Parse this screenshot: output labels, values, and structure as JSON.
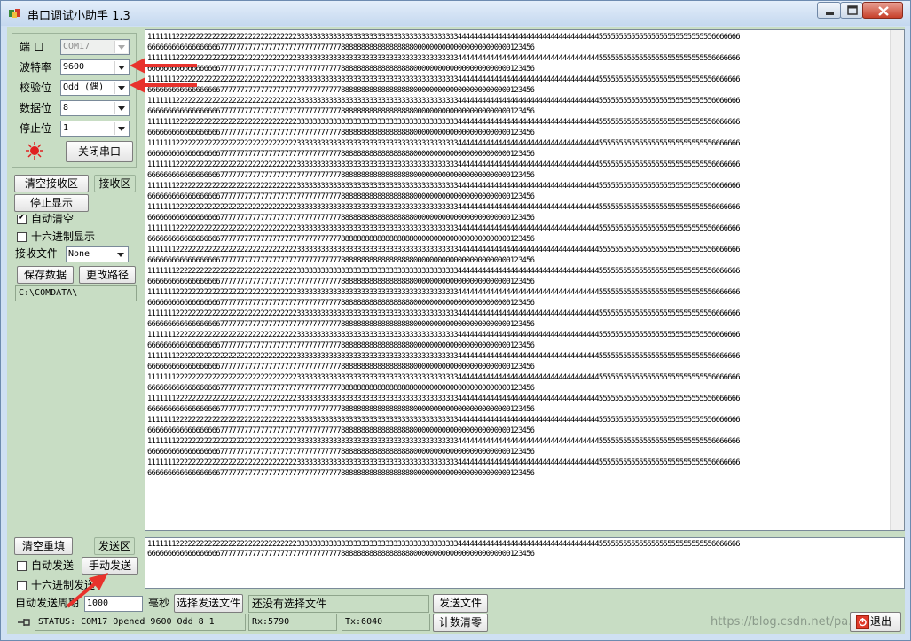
{
  "window": {
    "title": "串口调试小助手 1.3"
  },
  "port": {
    "port_label": "端  口",
    "port_value": "COM17",
    "baud_label": "波特率",
    "baud_value": "9600",
    "parity_label": "校验位",
    "parity_value": "Odd  (偶)",
    "databits_label": "数据位",
    "databits_value": "8",
    "stopbits_label": "停止位",
    "stopbits_value": "1",
    "toggle_label": "关闭串口",
    "indicator_color": "#e02020"
  },
  "receive": {
    "clear_label": "清空接收区",
    "area_label": "接收区",
    "stop_label": "停止显示",
    "auto_clear_label": "自动清空",
    "auto_clear_checked": true,
    "hex_label": "十六进制显示",
    "hex_checked": false,
    "file_label": "接收文件",
    "file_value": "None",
    "save_label": "保存数据",
    "path_button_label": "更改路径",
    "path_value": "C:\\COMDATA\\",
    "line_a": "111111122222222222222222222222222222233333333333333333333333333333333333333334444444444444444444444444444444444455555555555555555555555555556666666",
    "line_b": "666666666666666666777777777777777777777777777777888888888888888888000000000000000000000000123456",
    "pair_count": 21
  },
  "send": {
    "clear_label": "清空重填",
    "area_label": "发送区",
    "auto_send_label": "自动发送",
    "auto_send_checked": false,
    "manual_send_label": "手动发送",
    "hex_label": "十六进制发送",
    "hex_checked": false,
    "period_label": "自动发送周期",
    "period_value": "1000",
    "unit_label": "毫秒",
    "select_file_label": "选择发送文件",
    "file_status": "还没有选择文件",
    "send_file_label": "发送文件",
    "reset_count_label": "计数清零",
    "line_a": "111111122222222222222222222222222222233333333333333333333333333333333333333334444444444444444444444444444444444455555555555555555555555555556666666",
    "line_b": "666666666666666666777777777777777777777777777777888888888888888888000000000000000000000000123456"
  },
  "status": {
    "text": "STATUS: COM17 Opened 9600 Odd  8 1",
    "rx": "Rx:5790",
    "tx": "Tx:6040",
    "exit_label": "退出",
    "watermark": "https://blog.csdn.net/pa..."
  },
  "annotation_color": "#e8322c"
}
